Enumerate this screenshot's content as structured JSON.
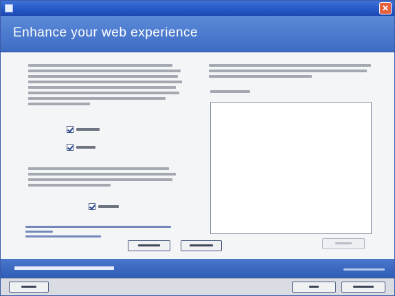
{
  "window": {
    "title": "",
    "close_glyph": "✕",
    "icon": "app-icon"
  },
  "banner": {
    "headline": "Enhance your web experience"
  },
  "left_panel": {
    "checkboxes": [
      {
        "checked": true
      },
      {
        "checked": true
      }
    ],
    "allow_once": {
      "checked": true
    }
  },
  "right_panel": {},
  "buttons": {
    "register": {
      "label": "",
      "enabled": true
    },
    "visit": {
      "label": "",
      "enabled": true
    },
    "remove": {
      "label": "",
      "enabled": false
    },
    "help": {
      "label": "",
      "enabled": true
    },
    "ok": {
      "label": "",
      "enabled": true
    },
    "cancel": {
      "label": "",
      "enabled": true
    }
  },
  "footer": {},
  "colors": {
    "titlebar": "#2456c4",
    "banner": "#4a7ad0",
    "footer": "#3b66bc",
    "content": "#f4f5f7"
  }
}
